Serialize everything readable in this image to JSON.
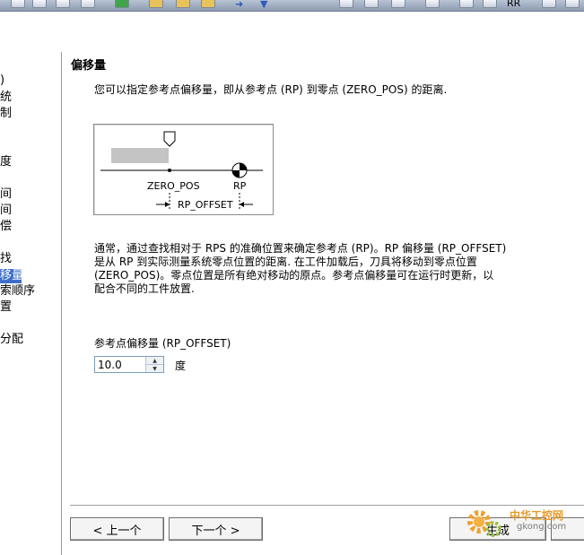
{
  "toolbar": {
    "text": "RR"
  },
  "nav": {
    "items": [
      ")",
      "统",
      "制",
      "度",
      "间",
      "间",
      "偿",
      "找",
      "移量",
      "索顺序",
      "置",
      "分配"
    ],
    "selected_index": 8
  },
  "main": {
    "title": "偏移量",
    "description": "您可以指定参考点偏移量，即从参考点 (RP) 到零点 (ZERO_POS) 的距离.",
    "diagram": {
      "zero_pos_label": "ZERO_POS",
      "rp_label": "RP",
      "offset_label": "RP_OFFSET"
    },
    "body_lines": [
      "通常，通过查找相对于 RPS 的准确位置来确定参考点 (RP)。RP 偏移量 (RP_OFFSET)",
      "是从 RP 到实际测量系统零点位置的距离. 在工件加载后，刀具将移动到零点位置",
      "(ZERO_POS)。零点位置是所有绝对移动的原点。参考点偏移量可在运行时更新，以",
      "配合不同的工件放置."
    ],
    "field": {
      "label": "参考点偏移量 (RP_OFFSET)",
      "value": "10.0",
      "unit": "度"
    }
  },
  "buttons": {
    "prev": "< 上一个",
    "next": "下一个 >",
    "generate": "生成"
  },
  "watermark": {
    "cn": "中华工控网",
    "url": "gkong.com"
  }
}
